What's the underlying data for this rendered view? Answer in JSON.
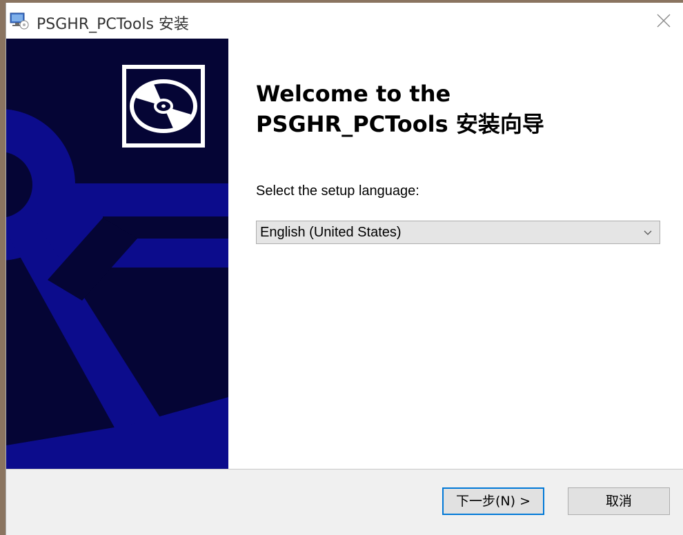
{
  "window": {
    "title": "PSGHR_PCTools 安装"
  },
  "content": {
    "welcome_line1": "Welcome to the",
    "welcome_line2": "PSGHR_PCTools 安装向导",
    "language_label": "Select the setup language:",
    "language_selected": "English (United States)"
  },
  "buttons": {
    "next_label": "下一步(N) >",
    "cancel_label": "取消"
  },
  "colors": {
    "sidebar_background": "#050535",
    "sidebar_anchor": "#0c0c8c",
    "focus_accent": "#0078d7"
  },
  "icons": {
    "title": "setup-computer-icon",
    "close": "close-icon",
    "logo": "disc-icon",
    "dropdown": "chevron-down-icon"
  }
}
